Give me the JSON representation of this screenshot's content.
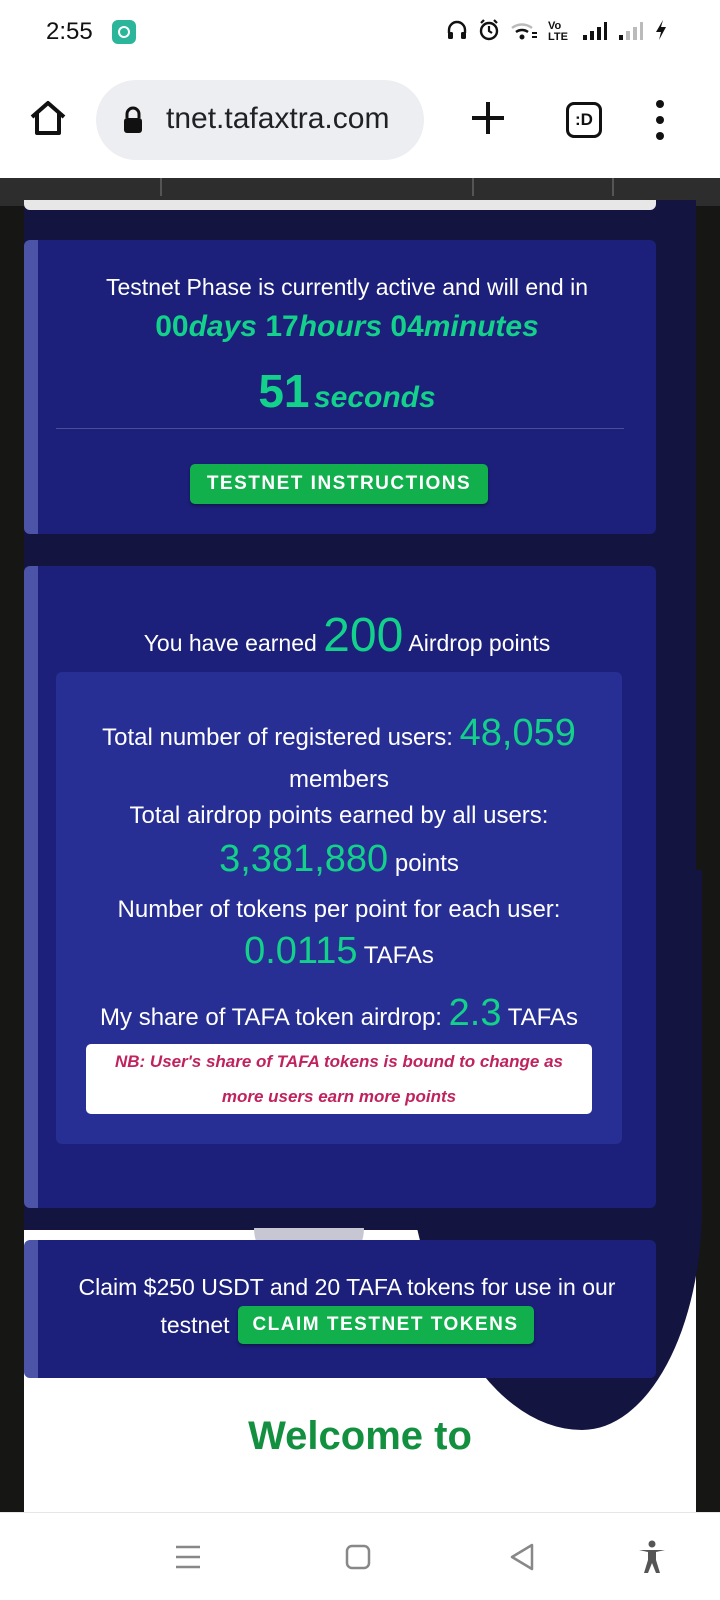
{
  "status_bar": {
    "time": "2:55",
    "icons": [
      "app-icon",
      "headphones-icon",
      "alarm-icon",
      "wifi-icon",
      "volte-icon",
      "signal-icon",
      "signal-weak-icon",
      "charging-icon"
    ],
    "volte_label": "Vo LTE"
  },
  "browser": {
    "url": "tnet.tafaxtra.com",
    "tabs_label": ":D"
  },
  "countdown": {
    "intro": "Testnet Phase is currently active and will end in",
    "days": "00",
    "days_unit": "days",
    "hours": "17",
    "hours_unit": "hours",
    "minutes": "04",
    "minutes_unit": "minutes",
    "seconds": "51",
    "seconds_unit": "seconds",
    "button": "TESTNET INSTRUCTIONS"
  },
  "airdrop": {
    "earned_prefix": "You have earned",
    "earned_value": "200",
    "earned_suffix": "Airdrop points",
    "registered_label": "Total number of registered users:",
    "registered_value": "48,059",
    "registered_unit": "members",
    "total_points_label": "Total airdrop points earned by all users:",
    "total_points_value": "3,381,880",
    "total_points_unit": "points",
    "tokens_per_point_label": "Number of tokens per point for each user:",
    "tokens_per_point_value": "0.0115",
    "tokens_per_point_unit": "TAFAs",
    "my_share_label": "My share of TAFA token airdrop:",
    "my_share_value": "2.3",
    "my_share_unit": "TAFAs",
    "note_line1": "NB: User's share of TAFA tokens is bound to change as",
    "note_line2": "more users earn more points"
  },
  "claim": {
    "line1": "Claim $250 USDT and 20 TAFA tokens for use in our",
    "line2": "testnet",
    "button": "CLAIM TESTNET TOKENS"
  },
  "welcome": "Welcome to",
  "colors": {
    "accent_green": "#13d08a",
    "button_green": "#12b04c",
    "card_blue": "#1c207a",
    "stats_blue": "#282f94",
    "note_red": "#c0225e"
  }
}
